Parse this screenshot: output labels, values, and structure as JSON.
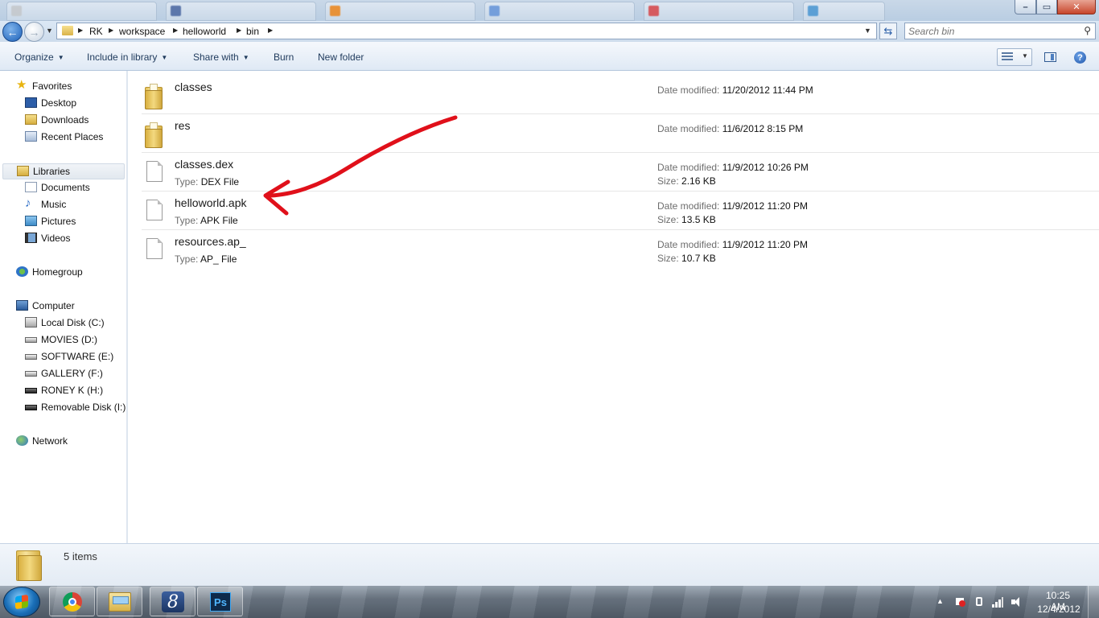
{
  "window": {
    "controls": {
      "minimize": "–",
      "maximize": "▭",
      "close": "✕"
    }
  },
  "address_bar": {
    "breadcrumbs": [
      "RK",
      "workspace",
      "helloworld",
      "bin"
    ]
  },
  "search": {
    "placeholder": "Search bin",
    "value": ""
  },
  "toolbar": {
    "organize": "Organize",
    "include_in_library": "Include in library",
    "share_with": "Share with",
    "burn": "Burn",
    "new_folder": "New folder"
  },
  "nav": {
    "favorites": "Favorites",
    "favorites_items": [
      "Desktop",
      "Downloads",
      "Recent Places"
    ],
    "libraries": "Libraries",
    "libraries_items": [
      "Documents",
      "Music",
      "Pictures",
      "Videos"
    ],
    "homegroup": "Homegroup",
    "computer": "Computer",
    "computer_items": [
      "Local Disk (C:)",
      "MOVIES (D:)",
      "SOFTWARE (E:)",
      "GALLERY (F:)",
      "RONEY K (H:)",
      "Removable Disk (I:)"
    ],
    "network": "Network"
  },
  "labels": {
    "date_modified": "Date modified:",
    "type": "Type:",
    "size": "Size:"
  },
  "files": [
    {
      "name": "classes",
      "kind": "folder",
      "date_modified": "11/20/2012 11:44 PM"
    },
    {
      "name": "res",
      "kind": "folder",
      "date_modified": "11/6/2012 8:15 PM"
    },
    {
      "name": "classes.dex",
      "kind": "file",
      "type": "DEX File",
      "date_modified": "11/9/2012 10:26 PM",
      "size": "2.16 KB"
    },
    {
      "name": "helloworld.apk",
      "kind": "file",
      "type": "APK File",
      "date_modified": "11/9/2012 11:20 PM",
      "size": "13.5 KB"
    },
    {
      "name": "resources.ap_",
      "kind": "file",
      "type": "AP_ File",
      "date_modified": "11/9/2012 11:20 PM",
      "size": "10.7 KB"
    }
  ],
  "details": {
    "item_count": "5 items"
  },
  "taskbar": {
    "time": "10:25 AM",
    "date": "12/4/2012",
    "app8_glyph": "8",
    "ps_glyph": "Ps"
  },
  "colors": {
    "annotation_arrow": "#e0101a",
    "accent": "#1e395b"
  }
}
